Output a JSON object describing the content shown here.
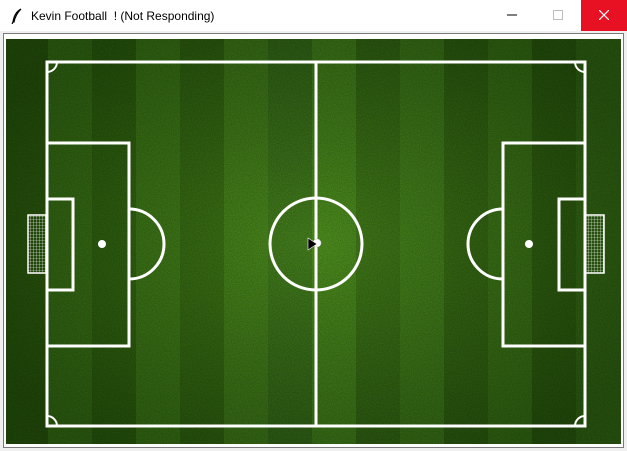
{
  "window": {
    "title": "Kevin Football  ! (Not Responding)",
    "app_icon": "feather-icon",
    "controls": {
      "minimize_icon": "minimize-icon",
      "maximize_icon": "maximize-icon",
      "close_icon": "close-icon",
      "close_color": "#e81123"
    }
  },
  "pitch": {
    "grass_dark": "#2f6a0e",
    "grass_light": "#3f8417",
    "line_color": "#ffffff",
    "ball_icon": "football-icon",
    "cursor_icon": "arrow-cursor-icon"
  }
}
